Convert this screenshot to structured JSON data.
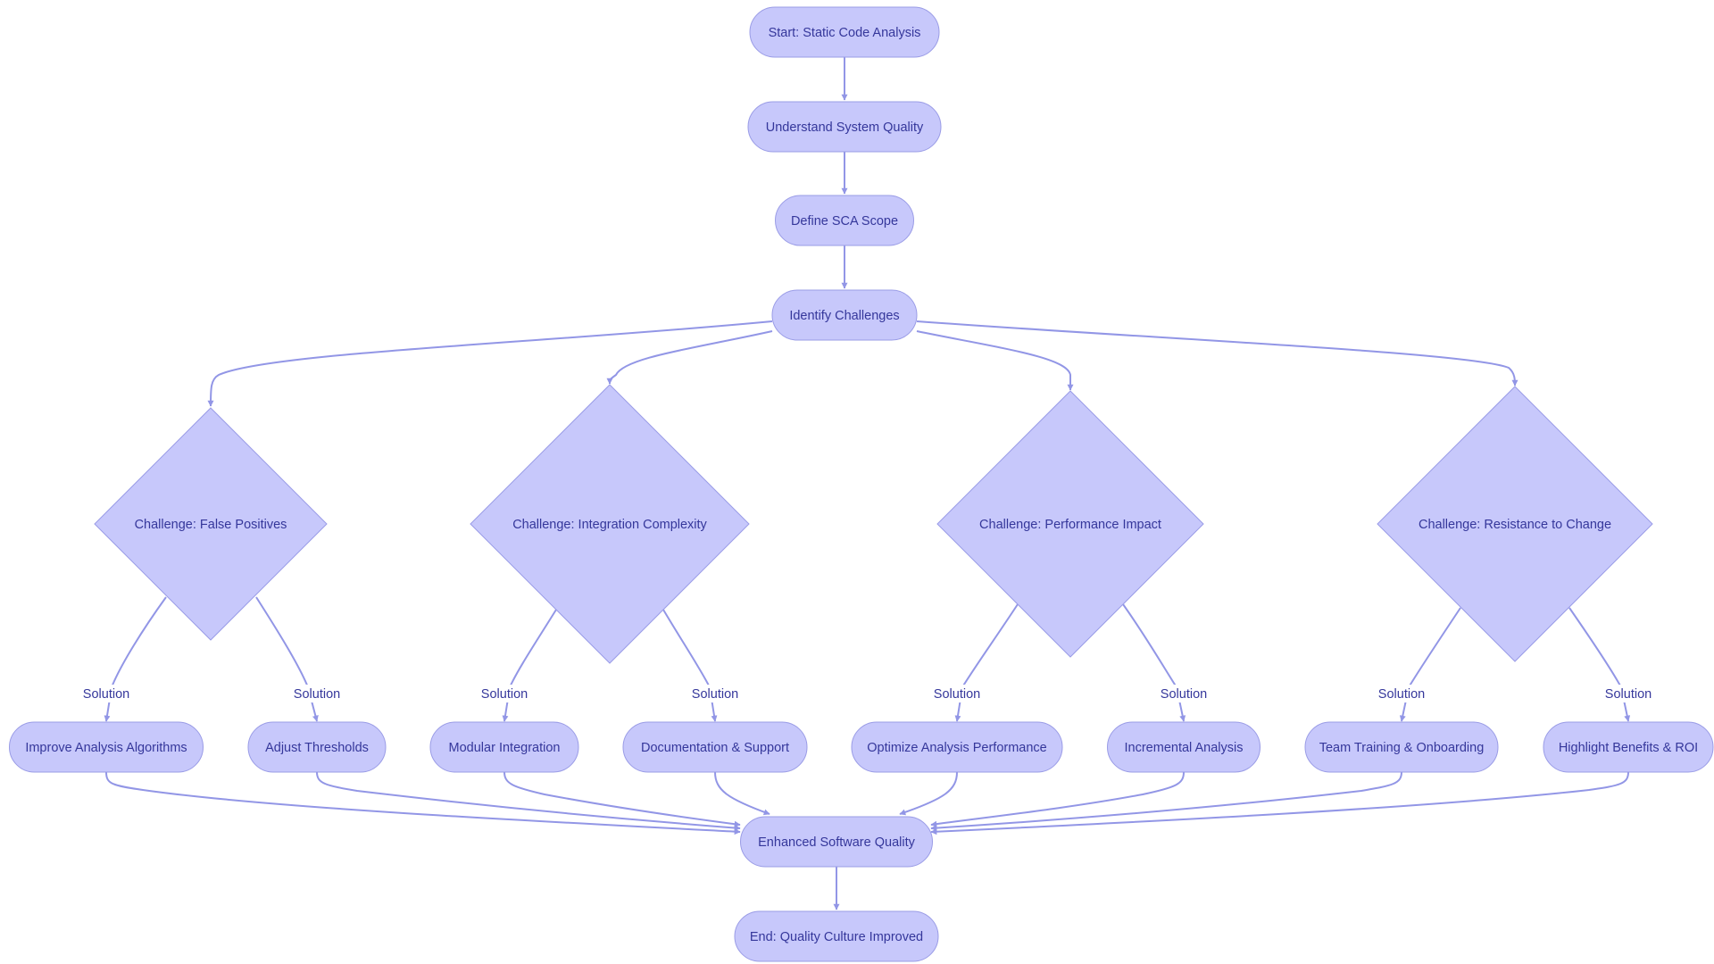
{
  "diagram": {
    "type": "flowchart",
    "direction": "top-down",
    "colors": {
      "node_fill": "#c7c8fb",
      "node_border": "#9a9ce6",
      "text": "#35379b",
      "edge": "#9296e6",
      "background": "#ffffff"
    },
    "nodes": [
      {
        "id": "start",
        "label": "Start: Static Code Analysis",
        "shape": "stadium"
      },
      {
        "id": "understand",
        "label": "Understand System Quality",
        "shape": "stadium"
      },
      {
        "id": "define",
        "label": "Define SCA Scope",
        "shape": "stadium"
      },
      {
        "id": "identify",
        "label": "Identify Challenges",
        "shape": "stadium"
      },
      {
        "id": "c1",
        "label": "Challenge: False Positives",
        "shape": "diamond"
      },
      {
        "id": "c2",
        "label": "Challenge: Integration Complexity",
        "shape": "diamond"
      },
      {
        "id": "c3",
        "label": "Challenge: Performance Impact",
        "shape": "diamond"
      },
      {
        "id": "c4",
        "label": "Challenge: Resistance to Change",
        "shape": "diamond"
      },
      {
        "id": "s1",
        "label": "Improve Analysis Algorithms",
        "shape": "stadium"
      },
      {
        "id": "s2",
        "label": "Adjust Thresholds",
        "shape": "stadium"
      },
      {
        "id": "s3",
        "label": "Modular Integration",
        "shape": "stadium"
      },
      {
        "id": "s4",
        "label": "Documentation & Support",
        "shape": "stadium"
      },
      {
        "id": "s5",
        "label": "Optimize Analysis Performance",
        "shape": "stadium"
      },
      {
        "id": "s6",
        "label": "Incremental Analysis",
        "shape": "stadium"
      },
      {
        "id": "s7",
        "label": "Team Training & Onboarding",
        "shape": "stadium"
      },
      {
        "id": "s8",
        "label": "Highlight Benefits & ROI",
        "shape": "stadium"
      },
      {
        "id": "enhanced",
        "label": "Enhanced Software Quality",
        "shape": "stadium"
      },
      {
        "id": "end",
        "label": "End: Quality Culture Improved",
        "shape": "stadium"
      }
    ],
    "edges": [
      {
        "from": "start",
        "to": "understand",
        "label": ""
      },
      {
        "from": "understand",
        "to": "define",
        "label": ""
      },
      {
        "from": "define",
        "to": "identify",
        "label": ""
      },
      {
        "from": "identify",
        "to": "c1",
        "label": ""
      },
      {
        "from": "identify",
        "to": "c2",
        "label": ""
      },
      {
        "from": "identify",
        "to": "c3",
        "label": ""
      },
      {
        "from": "identify",
        "to": "c4",
        "label": ""
      },
      {
        "from": "c1",
        "to": "s1",
        "label": "Solution"
      },
      {
        "from": "c1",
        "to": "s2",
        "label": "Solution"
      },
      {
        "from": "c2",
        "to": "s3",
        "label": "Solution"
      },
      {
        "from": "c2",
        "to": "s4",
        "label": "Solution"
      },
      {
        "from": "c3",
        "to": "s5",
        "label": "Solution"
      },
      {
        "from": "c3",
        "to": "s6",
        "label": "Solution"
      },
      {
        "from": "c4",
        "to": "s7",
        "label": "Solution"
      },
      {
        "from": "c4",
        "to": "s8",
        "label": "Solution"
      },
      {
        "from": "s1",
        "to": "enhanced",
        "label": ""
      },
      {
        "from": "s2",
        "to": "enhanced",
        "label": ""
      },
      {
        "from": "s3",
        "to": "enhanced",
        "label": ""
      },
      {
        "from": "s4",
        "to": "enhanced",
        "label": ""
      },
      {
        "from": "s5",
        "to": "enhanced",
        "label": ""
      },
      {
        "from": "s6",
        "to": "enhanced",
        "label": ""
      },
      {
        "from": "s7",
        "to": "enhanced",
        "label": ""
      },
      {
        "from": "s8",
        "to": "enhanced",
        "label": ""
      },
      {
        "from": "enhanced",
        "to": "end",
        "label": ""
      }
    ]
  }
}
